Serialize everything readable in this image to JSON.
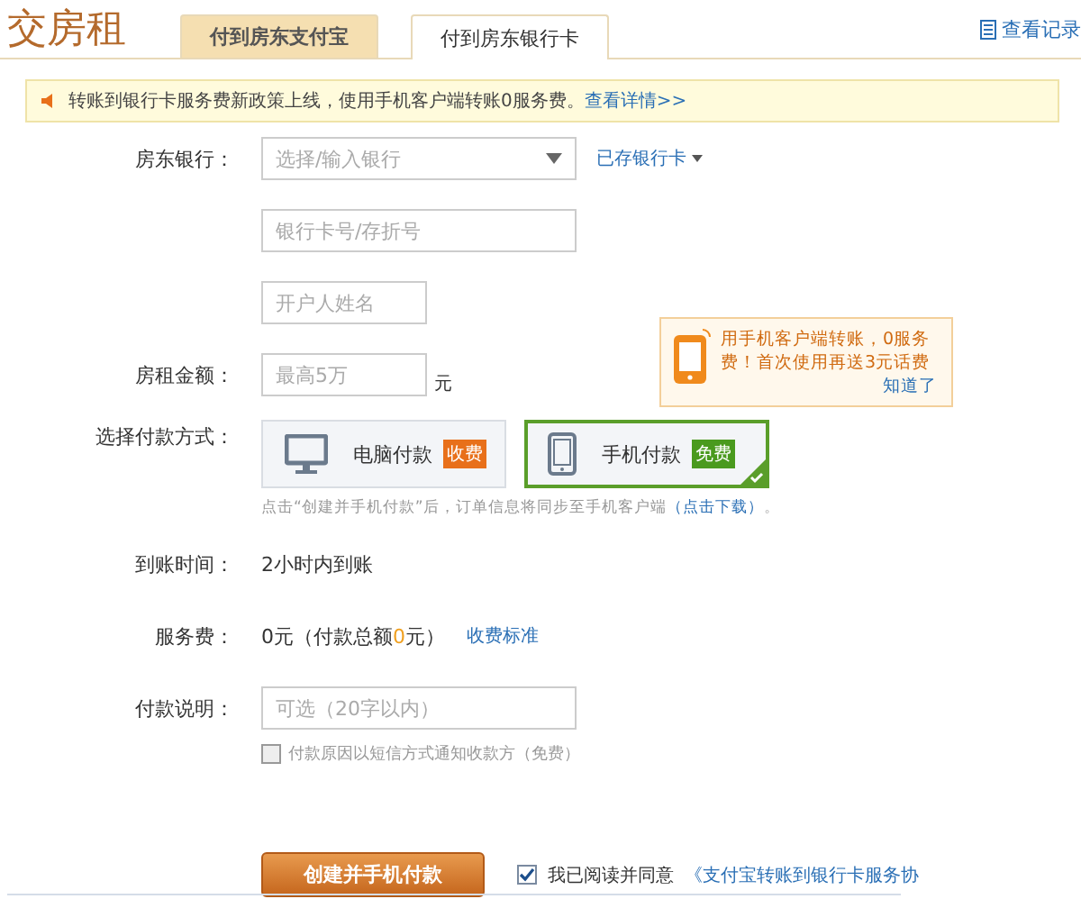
{
  "title": "交房租",
  "tabs": [
    {
      "label": "付到房东支付宝",
      "selected": false
    },
    {
      "label": "付到房东银行卡",
      "selected": true
    }
  ],
  "history_link": "查看记录",
  "notice": {
    "text": "转账到银行卡服务费新政策上线，使用手机客户端转账0服务费。",
    "link": "查看详情>>"
  },
  "bank": {
    "label": "房东银行：",
    "placeholder": "选择/输入银行",
    "saved_link": "已存银行卡"
  },
  "card_number": {
    "placeholder": "银行卡号/存折号"
  },
  "holder_name": {
    "placeholder": "开户人姓名"
  },
  "amount": {
    "label": "房租金额：",
    "placeholder": "最高5万",
    "unit": "元"
  },
  "tooltip": {
    "text": "用手机客户端转账，0服务费！首次使用再送3元话费",
    "link": "知道了"
  },
  "method": {
    "label": "选择付款方式：",
    "options": [
      {
        "kind": "desktop",
        "label": "电脑付款",
        "badge": "收费",
        "color": "#e8701a",
        "selected": false
      },
      {
        "kind": "phone",
        "label": "手机付款",
        "badge": "免费",
        "color": "#4a9a1e",
        "selected": true
      }
    ],
    "hint": "点击“创建并手机付款”后，订单信息将同步至手机客户端",
    "hint_link": "（点击下载）",
    "hint_end": "。"
  },
  "arrival": {
    "label": "到账时间：",
    "value": "2小时内到账"
  },
  "fee": {
    "label": "服务费：",
    "value_before": "0元（付款总额",
    "value_highlight": "0",
    "value_after": "元）",
    "link": "收费标准"
  },
  "note": {
    "label": "付款说明：",
    "placeholder": "可选（20字以内）"
  },
  "sms": {
    "label": "付款原因以短信方式通知收款方（免费）",
    "checked": false
  },
  "submit": "创建并手机付款",
  "agree": {
    "checked": true,
    "text": "我已阅读并同意",
    "link": "《支付宝转账到银行卡服务协"
  }
}
